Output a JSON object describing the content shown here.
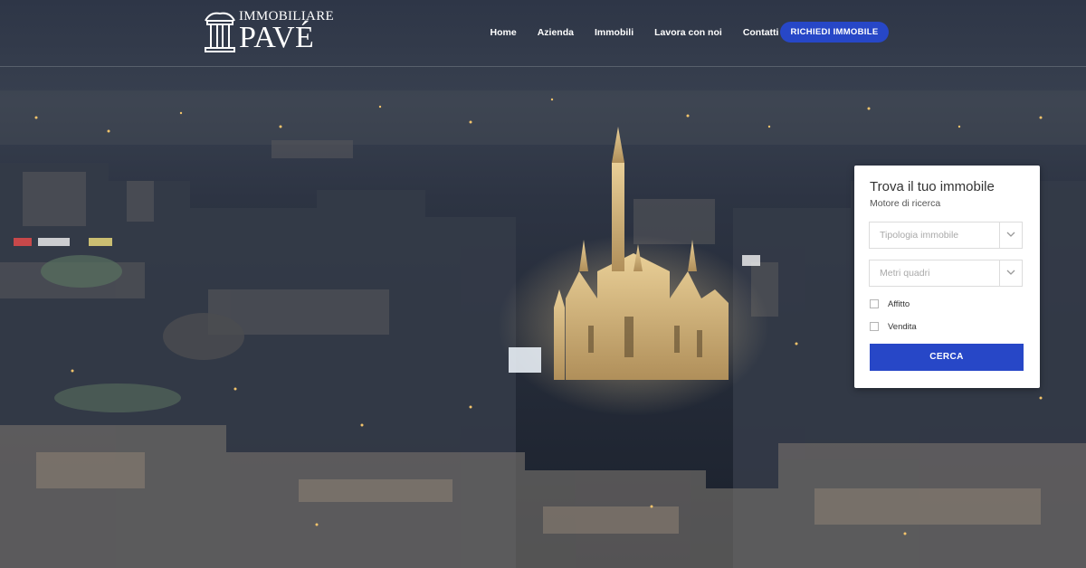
{
  "brand": {
    "name_top": "IMMOBILIARE",
    "name_main": "PAVÉ"
  },
  "nav": {
    "items": [
      {
        "label": "Home"
      },
      {
        "label": "Azienda"
      },
      {
        "label": "Immobili"
      },
      {
        "label": "Lavora con noi"
      },
      {
        "label": "Contatti"
      }
    ],
    "cta_label": "RICHIEDI IMMOBILE"
  },
  "search": {
    "title": "Trova il tuo immobile",
    "subtitle": "Motore di ricerca",
    "property_type_placeholder": "Tipologia immobile",
    "size_placeholder": "Metri quadri",
    "options": [
      {
        "label": "Affitto",
        "checked": false
      },
      {
        "label": "Vendita",
        "checked": false
      }
    ],
    "submit_label": "CERCA"
  },
  "colors": {
    "accent": "#2747c7",
    "night_sky": "#2b3344",
    "panel_bg": "#ffffff"
  },
  "icons": {
    "logo": "building-columns-icon",
    "dropdown": "chevron-down-icon"
  }
}
